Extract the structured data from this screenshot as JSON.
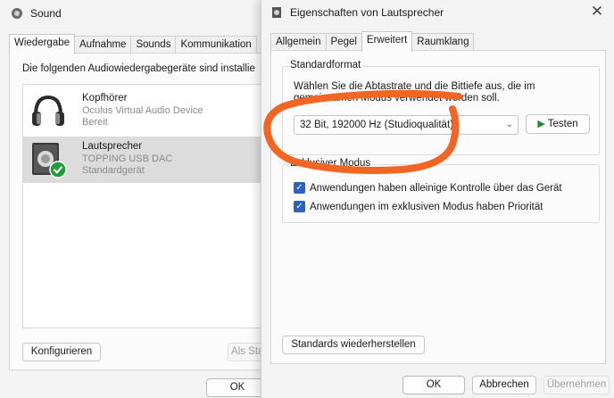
{
  "sound_window": {
    "title": "Sound",
    "tabs": [
      "Wiedergabe",
      "Aufnahme",
      "Sounds",
      "Kommunikation"
    ],
    "description": "Die folgenden Audiowiedergabegeräte sind installie",
    "devices": [
      {
        "name": "Kopfhörer",
        "line1": "Oculus Virtual Audio Device",
        "line2": "Bereit",
        "icon": "headphones-icon",
        "selected": false
      },
      {
        "name": "Lautsprecher",
        "line1": "TOPPING USB DAC",
        "line2": "Standardgerät",
        "icon": "speaker-icon",
        "selected": true
      }
    ],
    "configure_label": "Konfigurieren",
    "set_default_label": "Als Sta",
    "ok_label": "OK"
  },
  "props_window": {
    "title": "Eigenschaften von Lautsprecher",
    "tabs": [
      "Allgemein",
      "Pegel",
      "Erweitert",
      "Raumklang"
    ],
    "default_format": {
      "label": "Standardformat",
      "description_line1": "Wählen Sie die Abtastrate und die Bittiefe aus, die im",
      "description_line2": "gemeinsamen Modus verwendet werden soll.",
      "selected_value": "32 Bit, 192000 Hz (Studioqualität)",
      "test_label": "Testen"
    },
    "exclusive_mode": {
      "label": "Exklusiver Modus",
      "option1": "Anwendungen haben alleinige Kontrolle über das Gerät",
      "option2": "Anwendungen im exklusiven Modus haben Priorität",
      "option1_checked": true,
      "option2_checked": true
    },
    "restore_label": "Standards wiederherstellen",
    "ok_label": "OK",
    "cancel_label": "Abbrechen",
    "apply_label": "Übernehmen"
  },
  "colors": {
    "accent": "#2b63c2",
    "annotation": "#f26522",
    "play": "#1a8c2e",
    "check_badge": "#1f9e3a"
  }
}
